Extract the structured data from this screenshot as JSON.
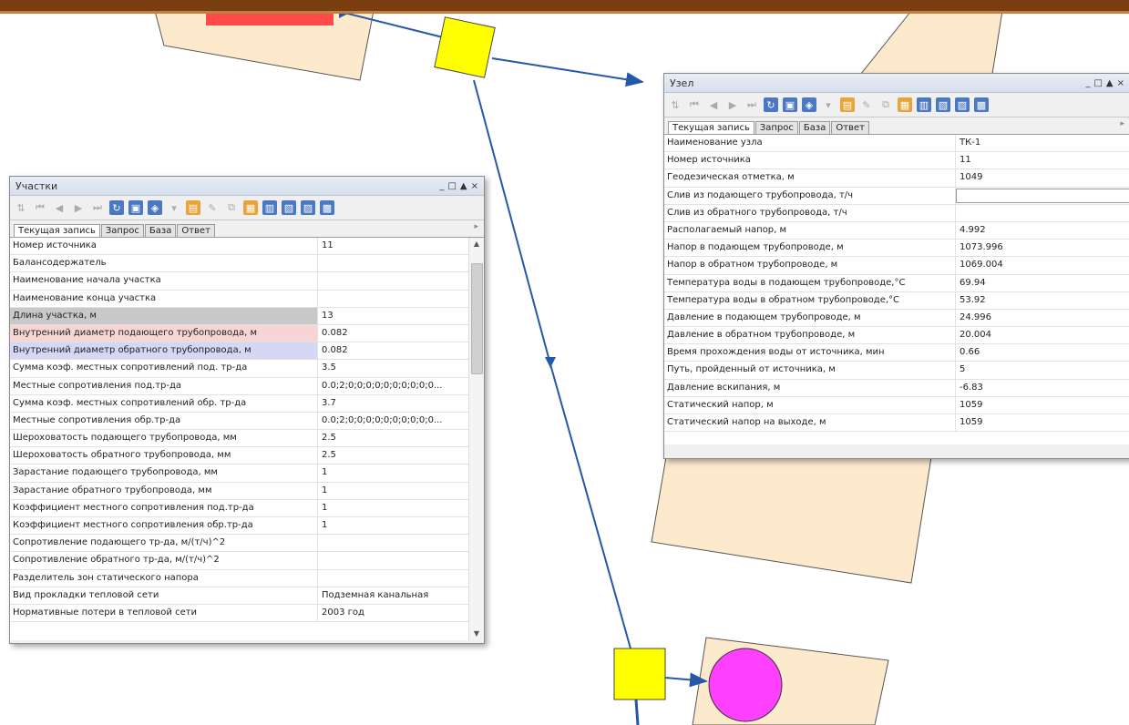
{
  "colors": {
    "line": "#2458a8",
    "parcel": "#fde9cc",
    "node": "#ffff00",
    "consumer": "#ff40ff",
    "source": "#ff4040",
    "topbar": "#7a3e10"
  },
  "window_uchastki": {
    "title": "Участки",
    "controls": [
      "_",
      "□",
      "▲",
      "×"
    ],
    "tabs": [
      "Текущая запись",
      "Запрос",
      "База",
      "Ответ"
    ],
    "rows": [
      {
        "name": "Номер источника",
        "value": "11"
      },
      {
        "name": "Балансодержатель",
        "value": ""
      },
      {
        "name": "Наименование начала участка",
        "value": ""
      },
      {
        "name": "Наименование конца участка",
        "value": ""
      },
      {
        "name": "Длина участка, м",
        "value": "13"
      },
      {
        "name": "Внутренний диаметр подающего трубопровода, м",
        "value": "0.082"
      },
      {
        "name": "Внутренний диаметр обратного трубопровода, м",
        "value": "0.082"
      },
      {
        "name": "Сумма коэф. местных сопротивлений под. тр-да",
        "value": "3.5"
      },
      {
        "name": "Местные сопротивления под.тр-да",
        "value": "0.0;2;0;0;0;0;0;0;0;0;0;0..."
      },
      {
        "name": "Сумма коэф. местных сопротивлений обр. тр-да",
        "value": "3.7"
      },
      {
        "name": "Местные сопротивления обр.тр-да",
        "value": "0.0;2;0;0;0;0;0;0;0;0;0;0..."
      },
      {
        "name": "Шероховатость подающего трубопровода, мм",
        "value": "2.5"
      },
      {
        "name": "Шероховатость обратного трубопровода, мм",
        "value": "2.5"
      },
      {
        "name": "Зарастание подающего трубопровода, мм",
        "value": "1"
      },
      {
        "name": "Зарастание обратного трубопровода, мм",
        "value": "1"
      },
      {
        "name": "Коэффициент местного сопротивления под.тр-да",
        "value": "1"
      },
      {
        "name": "Коэффициент местного сопротивления обр.тр-да",
        "value": "1"
      },
      {
        "name": "Сопротивление подающего тр-да, м/(т/ч)^2",
        "value": ""
      },
      {
        "name": "Сопротивление обратного тр-да, м/(т/ч)^2",
        "value": ""
      },
      {
        "name": "Разделитель зон статического напора",
        "value": ""
      },
      {
        "name": "Вид прокладки тепловой сети",
        "value": "Подземная канальная"
      },
      {
        "name": "Нормативные потери в тепловой сети",
        "value": "2003 год"
      }
    ]
  },
  "window_uzel": {
    "title": "Узел",
    "controls": [
      "_",
      "□",
      "▲",
      "×"
    ],
    "tabs": [
      "Текущая запись",
      "Запрос",
      "База",
      "Ответ"
    ],
    "rows": [
      {
        "name": "Наименование узла",
        "value": "ТК-1"
      },
      {
        "name": "Номер источника",
        "value": "11"
      },
      {
        "name": "Геодезическая отметка, м",
        "value": "1049"
      },
      {
        "name": "Слив из подающего трубопровода, т/ч",
        "value": ""
      },
      {
        "name": "Слив из обратного трубопровода, т/ч",
        "value": ""
      },
      {
        "name": "Располагаемый напор, м",
        "value": "4.992"
      },
      {
        "name": "Напор в подающем трубопроводе, м",
        "value": "1073.996"
      },
      {
        "name": "Напор в обратном трубопроводе, м",
        "value": "1069.004"
      },
      {
        "name": "Температура воды в подающем трубопроводе,°С",
        "value": "69.94"
      },
      {
        "name": "Температура воды в обратном трубопроводе,°С",
        "value": "53.92"
      },
      {
        "name": "Давление в подающем трубопроводе, м",
        "value": "24.996"
      },
      {
        "name": "Давление в обратном трубопроводе, м",
        "value": "20.004"
      },
      {
        "name": "Время прохождения воды от источника, мин",
        "value": "0.66"
      },
      {
        "name": "Путь, пройденный от источника, м",
        "value": "5"
      },
      {
        "name": "Давление вскипания, м",
        "value": "-6.83"
      },
      {
        "name": "Статический напор, м",
        "value": "1059"
      },
      {
        "name": "Статический напор на выходе, м",
        "value": "1059"
      }
    ]
  }
}
